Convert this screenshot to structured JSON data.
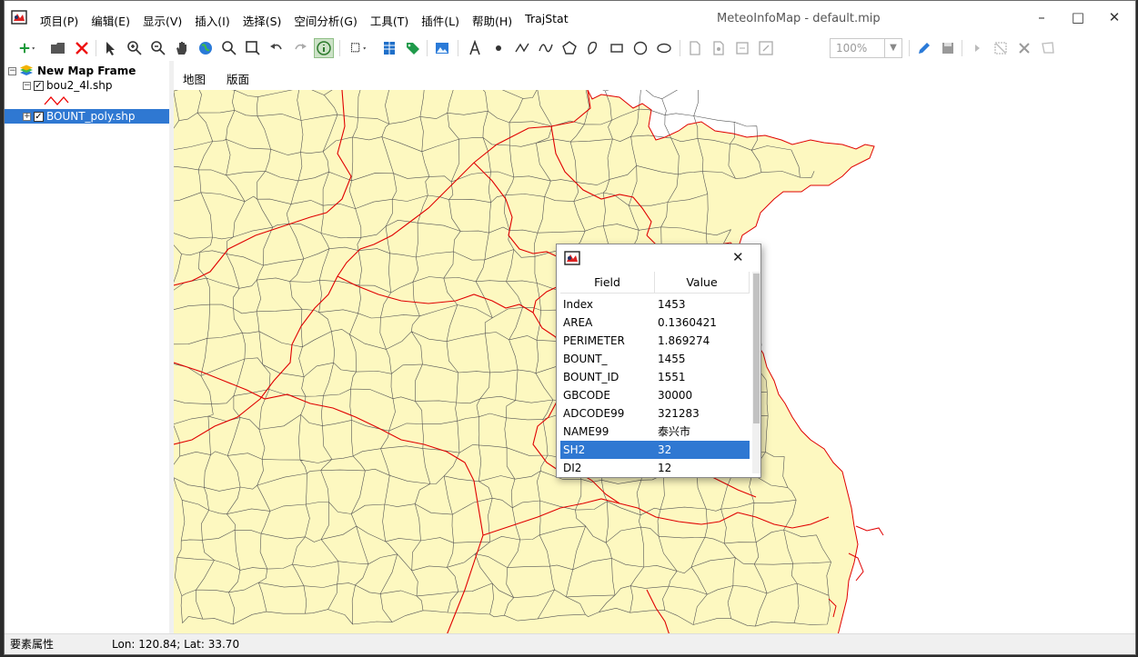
{
  "window": {
    "title": "MeteoInfoMap - default.mip",
    "menu": [
      "项目(P)",
      "编辑(E)",
      "显示(V)",
      "插入(I)",
      "选择(S)",
      "空间分析(G)",
      "工具(T)",
      "插件(L)",
      "帮助(H)",
      "TrajStat"
    ]
  },
  "toolbar": {
    "zoom_value": "100%"
  },
  "layers": {
    "frame": "New Map Frame",
    "layer1": "bou2_4l.shp",
    "layer2": "BOUNT_poly.shp"
  },
  "tabs": {
    "map": "地图",
    "layout": "版面"
  },
  "dialog": {
    "header_field": "Field",
    "header_value": "Value",
    "rows": [
      {
        "field": "Index",
        "value": "1453"
      },
      {
        "field": "AREA",
        "value": "0.1360421"
      },
      {
        "field": "PERIMETER",
        "value": "1.869274"
      },
      {
        "field": "BOUNT_",
        "value": "1455"
      },
      {
        "field": "BOUNT_ID",
        "value": "1551"
      },
      {
        "field": "GBCODE",
        "value": "30000"
      },
      {
        "field": "ADCODE99",
        "value": "321283"
      },
      {
        "field": "NAME99",
        "value": "泰兴市"
      },
      {
        "field": "SH2",
        "value": "32"
      },
      {
        "field": "DI2",
        "value": "12"
      }
    ],
    "selected_row": "SH2"
  },
  "status": {
    "left": "要素属性",
    "coords": "Lon: 120.84; Lat: 33.70"
  },
  "colors": {
    "land": "#fdf8c0",
    "province_border": "#e00000",
    "county_border": "#555555",
    "accent": "#2f78d2"
  }
}
